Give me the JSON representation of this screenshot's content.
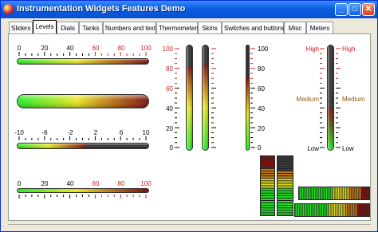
{
  "window": {
    "title": "Instrumentation Widgets Features Demo",
    "minimize_label": "_",
    "maximize_label": "□",
    "close_label": "✕"
  },
  "tabs": [
    {
      "label": "Sliders"
    },
    {
      "label": "Levels"
    },
    {
      "label": "Dials"
    },
    {
      "label": "Tanks"
    },
    {
      "label": "Numbers and text"
    },
    {
      "label": "Thermometers"
    },
    {
      "label": "Skins"
    },
    {
      "label": "Switches and buttons"
    },
    {
      "label": "Misc"
    },
    {
      "label": "Meters"
    }
  ],
  "active_tab": "Levels",
  "colors": {
    "red": "#cc2222",
    "green": "#22dd22",
    "yellow": "#f0e020",
    "brown": "#8a5a10"
  },
  "levels": {
    "h1": {
      "ticks": [
        "0",
        "20",
        "40",
        "60",
        "80",
        "100"
      ],
      "value_fraction": 1.0
    },
    "h2": {
      "value_fraction": 1.0
    },
    "h3": {
      "ticks": [
        "-10",
        "-6",
        "-2",
        "2",
        "6",
        "10"
      ],
      "value_fraction": 0.53
    },
    "h4": {
      "ticks": [
        "0",
        "20",
        "40",
        "60",
        "80",
        "100"
      ],
      "value_fraction": 1.0
    },
    "v1": {
      "ticks": [
        "100",
        "80",
        "60",
        "40",
        "20",
        "0"
      ],
      "value_fraction": 0.8
    },
    "v2": {
      "value_fraction": 0.82
    },
    "v3": {
      "ticks": [
        "100",
        "80",
        "60",
        "40",
        "20",
        "0"
      ],
      "value_fraction": 0.7
    },
    "v4": {
      "top_left": "High",
      "top_right": "High",
      "mid_left": "Medium",
      "mid_right": "Medium",
      "bottom_left": "Low",
      "bottom_right": "Low",
      "value_fraction": 0.4
    }
  }
}
